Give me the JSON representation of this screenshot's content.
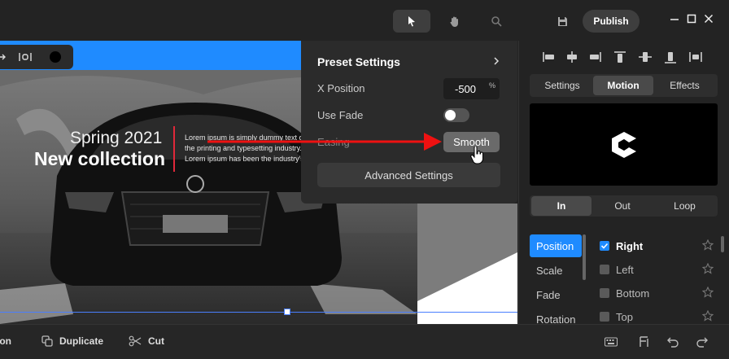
{
  "toolbar": {
    "tools": [
      "select-tool",
      "hand-tool",
      "zoom-tool"
    ],
    "save_icon": "save-icon",
    "publish_label": "Publish"
  },
  "canvas": {
    "headline_small": "Spring 2021",
    "headline_big": "New collection",
    "body_text": "Lorem ipsum is simply dummy text of the printing and typesetting industry. Lorem ipsum has been the industry's standard dummy",
    "accent_color": "#1f8bff",
    "bar_color": "#e0283a"
  },
  "preset": {
    "title": "Preset Settings",
    "x_label": "X Position",
    "x_value": "-500",
    "x_unit": "%",
    "fade_label": "Use Fade",
    "fade_on": false,
    "easing_label": "Easing",
    "easing_value": "Smooth",
    "advanced_label": "Advanced Settings"
  },
  "panel": {
    "tabs": [
      {
        "label": "Settings",
        "active": false
      },
      {
        "label": "Motion",
        "active": true
      },
      {
        "label": "Effects",
        "active": false
      }
    ],
    "modes": [
      {
        "label": "In",
        "active": true
      },
      {
        "label": "Out",
        "active": false
      },
      {
        "label": "Loop",
        "active": false
      }
    ],
    "categories": [
      "Position",
      "Scale",
      "Fade",
      "Rotation"
    ],
    "active_category": "Position",
    "directions": [
      {
        "label": "Right",
        "checked": true
      },
      {
        "label": "Left",
        "checked": false
      },
      {
        "label": "Bottom",
        "checked": false
      },
      {
        "label": "Top",
        "checked": false
      }
    ]
  },
  "bottombar": {
    "cut_prefix": "ion",
    "duplicate_label": "Duplicate",
    "cut_label": "Cut"
  }
}
